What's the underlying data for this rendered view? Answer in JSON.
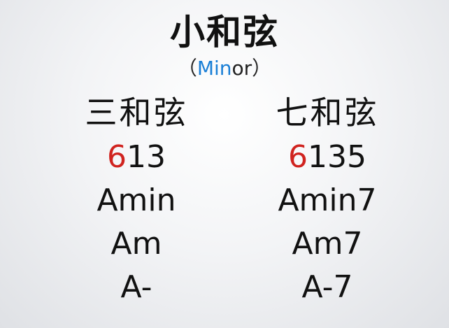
{
  "slide": {
    "title": "小和弦",
    "subtitle": {
      "open": "（",
      "highlight": "Min",
      "rest": "or",
      "close": "）",
      "highlight_color": "#1a7fd6"
    },
    "columns": [
      {
        "heading": "三和弦",
        "degrees": {
          "root": "6",
          "rest": "13",
          "root_color": "#d0231f"
        },
        "names": [
          "Amin",
          "Am",
          "A-"
        ]
      },
      {
        "heading": "七和弦",
        "degrees": {
          "root": "6",
          "rest": "135",
          "root_color": "#d0231f"
        },
        "names": [
          "Amin7",
          "Am7",
          "A-7"
        ]
      }
    ]
  }
}
